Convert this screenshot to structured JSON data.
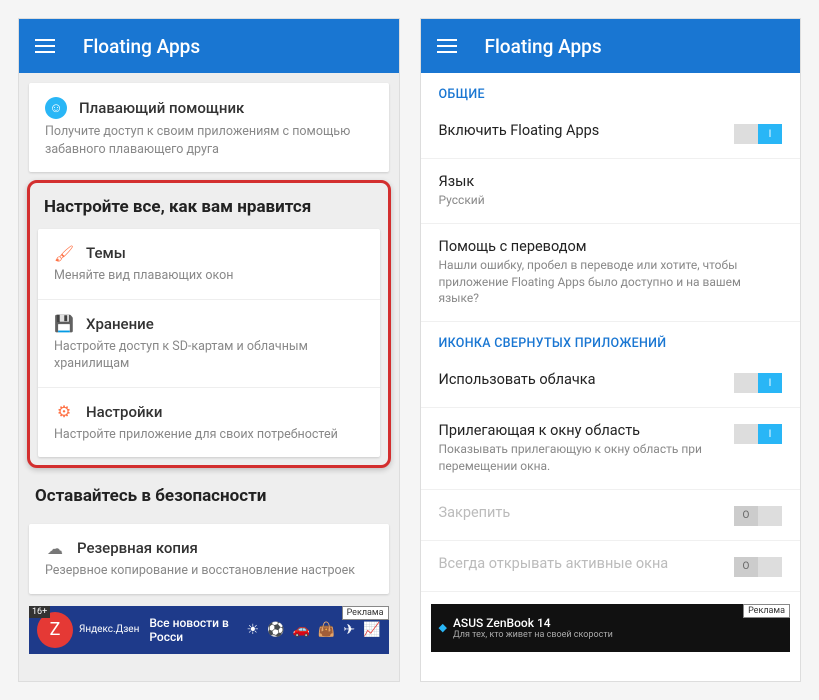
{
  "left": {
    "app_title": "Floating Apps",
    "helper": {
      "title": "Плавающий помощник",
      "desc": "Получите доступ к своим приложениям с помощью забавного плавающего друга"
    },
    "customize_section": "Настройте все, как вам нравится",
    "themes": {
      "title": "Темы",
      "desc": "Меняйте вид плавающих окон"
    },
    "storage": {
      "title": "Хранение",
      "desc": "Настройте доступ к SD-картам и облачным хранилищам"
    },
    "settings": {
      "title": "Настройки",
      "desc": "Настройте приложение для своих потребностей"
    },
    "safety_section": "Оставайтесь в безопасности",
    "backup": {
      "title": "Резервная копия",
      "desc": "Резервное копирование и восстановление настроек"
    },
    "ad": {
      "zen": "Z",
      "zen_label": "Яндекс.Дзен",
      "text": "Все новости в Росси",
      "tag": "Реклама",
      "age": "16+"
    }
  },
  "right": {
    "app_title": "Floating Apps",
    "sec_general": "ОБЩИЕ",
    "enable": {
      "title": "Включить Floating Apps"
    },
    "lang": {
      "title": "Язык",
      "value": "Русский"
    },
    "translate": {
      "title": "Помощь с переводом",
      "desc": "Нашли ошибку, пробел в переводе или хотите, чтобы приложение Floating Apps было доступно и на вашем языке?"
    },
    "sec_icon": "ИКОНКА СВЕРНУТЫХ ПРИЛОЖЕНИЙ",
    "bubbles": {
      "title": "Использовать облачка"
    },
    "adjacent": {
      "title": "Прилегающая к окну область",
      "desc": "Показывать прилегающую к окну область при перемещении окна."
    },
    "pin": {
      "title": "Закрепить"
    },
    "always_open": {
      "title": "Всегда открывать активные окна"
    },
    "ad": {
      "text": "ASUS ZenBook 14",
      "sub": "Для тех, кто живет на своей скорости",
      "tag": "Реклама"
    }
  }
}
